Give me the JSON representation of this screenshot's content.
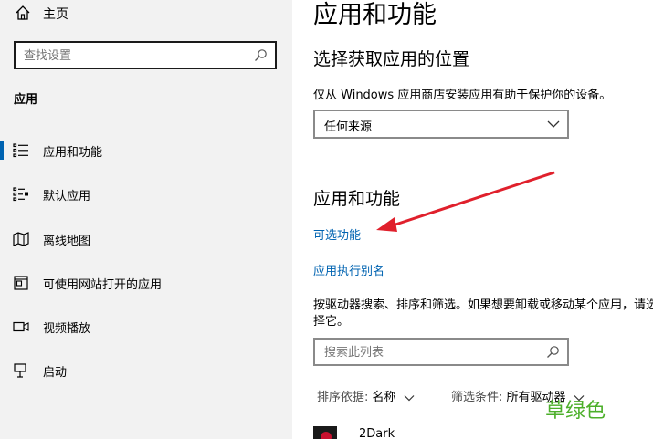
{
  "sidebar": {
    "home_label": "主页",
    "search_placeholder": "查找设置",
    "section_label": "应用",
    "items": [
      {
        "label": "应用和功能",
        "icon": "apps-features-icon",
        "active": true
      },
      {
        "label": "默认应用",
        "icon": "default-apps-icon"
      },
      {
        "label": "离线地图",
        "icon": "offline-maps-icon"
      },
      {
        "label": "可使用网站打开的应用",
        "icon": "apps-for-websites-icon"
      },
      {
        "label": "视频播放",
        "icon": "video-playback-icon"
      },
      {
        "label": "启动",
        "icon": "startup-icon"
      }
    ]
  },
  "main": {
    "title": "应用和功能",
    "choose_location_title": "选择获取应用的位置",
    "choose_location_desc": "仅从 Windows 应用商店安装应用有助于保护你的设备。",
    "source_dropdown_value": "任何来源",
    "apps_features_title": "应用和功能",
    "optional_features_link": "可选功能",
    "app_aliases_link": "应用执行别名",
    "search_desc": "按驱动器搜索、排序和筛选。如果想要卸载或移动某个应用，请选择它。",
    "list_search_placeholder": "搜索此列表",
    "sort_label": "排序依据:",
    "sort_value": "名称",
    "filter_label": "筛选条件:",
    "filter_value": "所有驱动器",
    "first_app_name": "2Dark"
  },
  "watermark": "草绿色",
  "colors": {
    "accent": "#0063b1",
    "sidebar_bg": "#f2f2f2",
    "annotation_arrow": "#e0202c",
    "watermark": "#4caf2a"
  }
}
